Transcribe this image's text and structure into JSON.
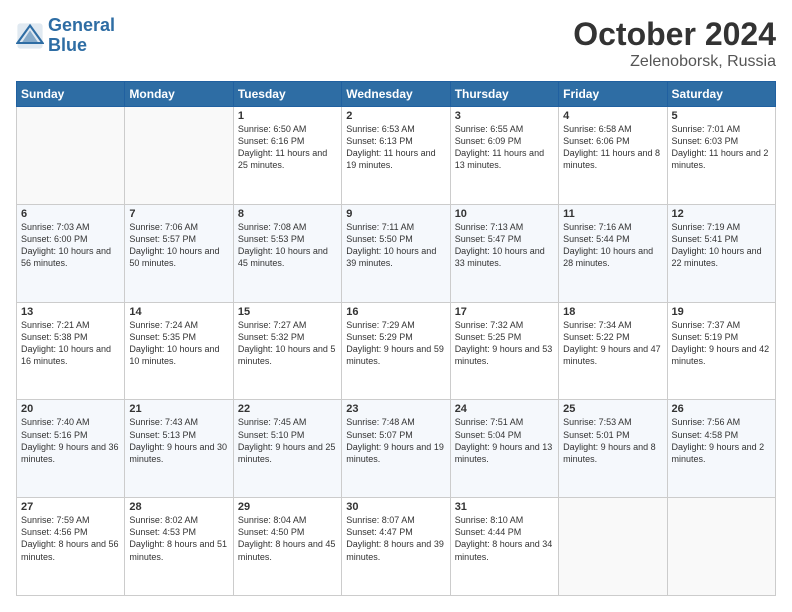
{
  "header": {
    "logo_line1": "General",
    "logo_line2": "Blue",
    "month_title": "October 2024",
    "location": "Zelenoborsk, Russia"
  },
  "weekdays": [
    "Sunday",
    "Monday",
    "Tuesday",
    "Wednesday",
    "Thursday",
    "Friday",
    "Saturday"
  ],
  "rows": [
    [
      {
        "num": "",
        "info": ""
      },
      {
        "num": "",
        "info": ""
      },
      {
        "num": "1",
        "info": "Sunrise: 6:50 AM\nSunset: 6:16 PM\nDaylight: 11 hours\nand 25 minutes."
      },
      {
        "num": "2",
        "info": "Sunrise: 6:53 AM\nSunset: 6:13 PM\nDaylight: 11 hours\nand 19 minutes."
      },
      {
        "num": "3",
        "info": "Sunrise: 6:55 AM\nSunset: 6:09 PM\nDaylight: 11 hours\nand 13 minutes."
      },
      {
        "num": "4",
        "info": "Sunrise: 6:58 AM\nSunset: 6:06 PM\nDaylight: 11 hours\nand 8 minutes."
      },
      {
        "num": "5",
        "info": "Sunrise: 7:01 AM\nSunset: 6:03 PM\nDaylight: 11 hours\nand 2 minutes."
      }
    ],
    [
      {
        "num": "6",
        "info": "Sunrise: 7:03 AM\nSunset: 6:00 PM\nDaylight: 10 hours\nand 56 minutes."
      },
      {
        "num": "7",
        "info": "Sunrise: 7:06 AM\nSunset: 5:57 PM\nDaylight: 10 hours\nand 50 minutes."
      },
      {
        "num": "8",
        "info": "Sunrise: 7:08 AM\nSunset: 5:53 PM\nDaylight: 10 hours\nand 45 minutes."
      },
      {
        "num": "9",
        "info": "Sunrise: 7:11 AM\nSunset: 5:50 PM\nDaylight: 10 hours\nand 39 minutes."
      },
      {
        "num": "10",
        "info": "Sunrise: 7:13 AM\nSunset: 5:47 PM\nDaylight: 10 hours\nand 33 minutes."
      },
      {
        "num": "11",
        "info": "Sunrise: 7:16 AM\nSunset: 5:44 PM\nDaylight: 10 hours\nand 28 minutes."
      },
      {
        "num": "12",
        "info": "Sunrise: 7:19 AM\nSunset: 5:41 PM\nDaylight: 10 hours\nand 22 minutes."
      }
    ],
    [
      {
        "num": "13",
        "info": "Sunrise: 7:21 AM\nSunset: 5:38 PM\nDaylight: 10 hours\nand 16 minutes."
      },
      {
        "num": "14",
        "info": "Sunrise: 7:24 AM\nSunset: 5:35 PM\nDaylight: 10 hours\nand 10 minutes."
      },
      {
        "num": "15",
        "info": "Sunrise: 7:27 AM\nSunset: 5:32 PM\nDaylight: 10 hours\nand 5 minutes."
      },
      {
        "num": "16",
        "info": "Sunrise: 7:29 AM\nSunset: 5:29 PM\nDaylight: 9 hours\nand 59 minutes."
      },
      {
        "num": "17",
        "info": "Sunrise: 7:32 AM\nSunset: 5:25 PM\nDaylight: 9 hours\nand 53 minutes."
      },
      {
        "num": "18",
        "info": "Sunrise: 7:34 AM\nSunset: 5:22 PM\nDaylight: 9 hours\nand 47 minutes."
      },
      {
        "num": "19",
        "info": "Sunrise: 7:37 AM\nSunset: 5:19 PM\nDaylight: 9 hours\nand 42 minutes."
      }
    ],
    [
      {
        "num": "20",
        "info": "Sunrise: 7:40 AM\nSunset: 5:16 PM\nDaylight: 9 hours\nand 36 minutes."
      },
      {
        "num": "21",
        "info": "Sunrise: 7:43 AM\nSunset: 5:13 PM\nDaylight: 9 hours\nand 30 minutes."
      },
      {
        "num": "22",
        "info": "Sunrise: 7:45 AM\nSunset: 5:10 PM\nDaylight: 9 hours\nand 25 minutes."
      },
      {
        "num": "23",
        "info": "Sunrise: 7:48 AM\nSunset: 5:07 PM\nDaylight: 9 hours\nand 19 minutes."
      },
      {
        "num": "24",
        "info": "Sunrise: 7:51 AM\nSunset: 5:04 PM\nDaylight: 9 hours\nand 13 minutes."
      },
      {
        "num": "25",
        "info": "Sunrise: 7:53 AM\nSunset: 5:01 PM\nDaylight: 9 hours\nand 8 minutes."
      },
      {
        "num": "26",
        "info": "Sunrise: 7:56 AM\nSunset: 4:58 PM\nDaylight: 9 hours\nand 2 minutes."
      }
    ],
    [
      {
        "num": "27",
        "info": "Sunrise: 7:59 AM\nSunset: 4:56 PM\nDaylight: 8 hours\nand 56 minutes."
      },
      {
        "num": "28",
        "info": "Sunrise: 8:02 AM\nSunset: 4:53 PM\nDaylight: 8 hours\nand 51 minutes."
      },
      {
        "num": "29",
        "info": "Sunrise: 8:04 AM\nSunset: 4:50 PM\nDaylight: 8 hours\nand 45 minutes."
      },
      {
        "num": "30",
        "info": "Sunrise: 8:07 AM\nSunset: 4:47 PM\nDaylight: 8 hours\nand 39 minutes."
      },
      {
        "num": "31",
        "info": "Sunrise: 8:10 AM\nSunset: 4:44 PM\nDaylight: 8 hours\nand 34 minutes."
      },
      {
        "num": "",
        "info": ""
      },
      {
        "num": "",
        "info": ""
      }
    ]
  ]
}
